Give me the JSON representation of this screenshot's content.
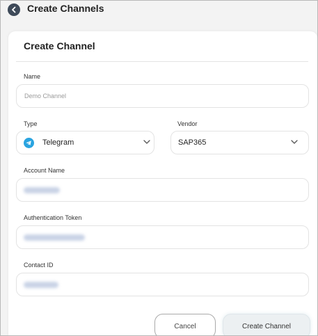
{
  "header": {
    "title": "Create Channels",
    "back_icon": "back-arrow-icon"
  },
  "card": {
    "title": "Create Channel"
  },
  "form": {
    "name": {
      "label": "Name",
      "placeholder": "Demo Channel"
    },
    "type": {
      "label": "Type",
      "value": "Telegram",
      "icon": "telegram-icon"
    },
    "vendor": {
      "label": "Vendor",
      "value": "SAP365"
    },
    "account_name": {
      "label": "Account Name"
    },
    "auth_token": {
      "label": "Authentication Token"
    },
    "contact_id": {
      "label": "Contact ID"
    }
  },
  "actions": {
    "cancel_label": "Cancel",
    "create_label": "Create Channel"
  },
  "colors": {
    "telegram": "#2aa4e0",
    "back_button": "#3e4a59"
  }
}
